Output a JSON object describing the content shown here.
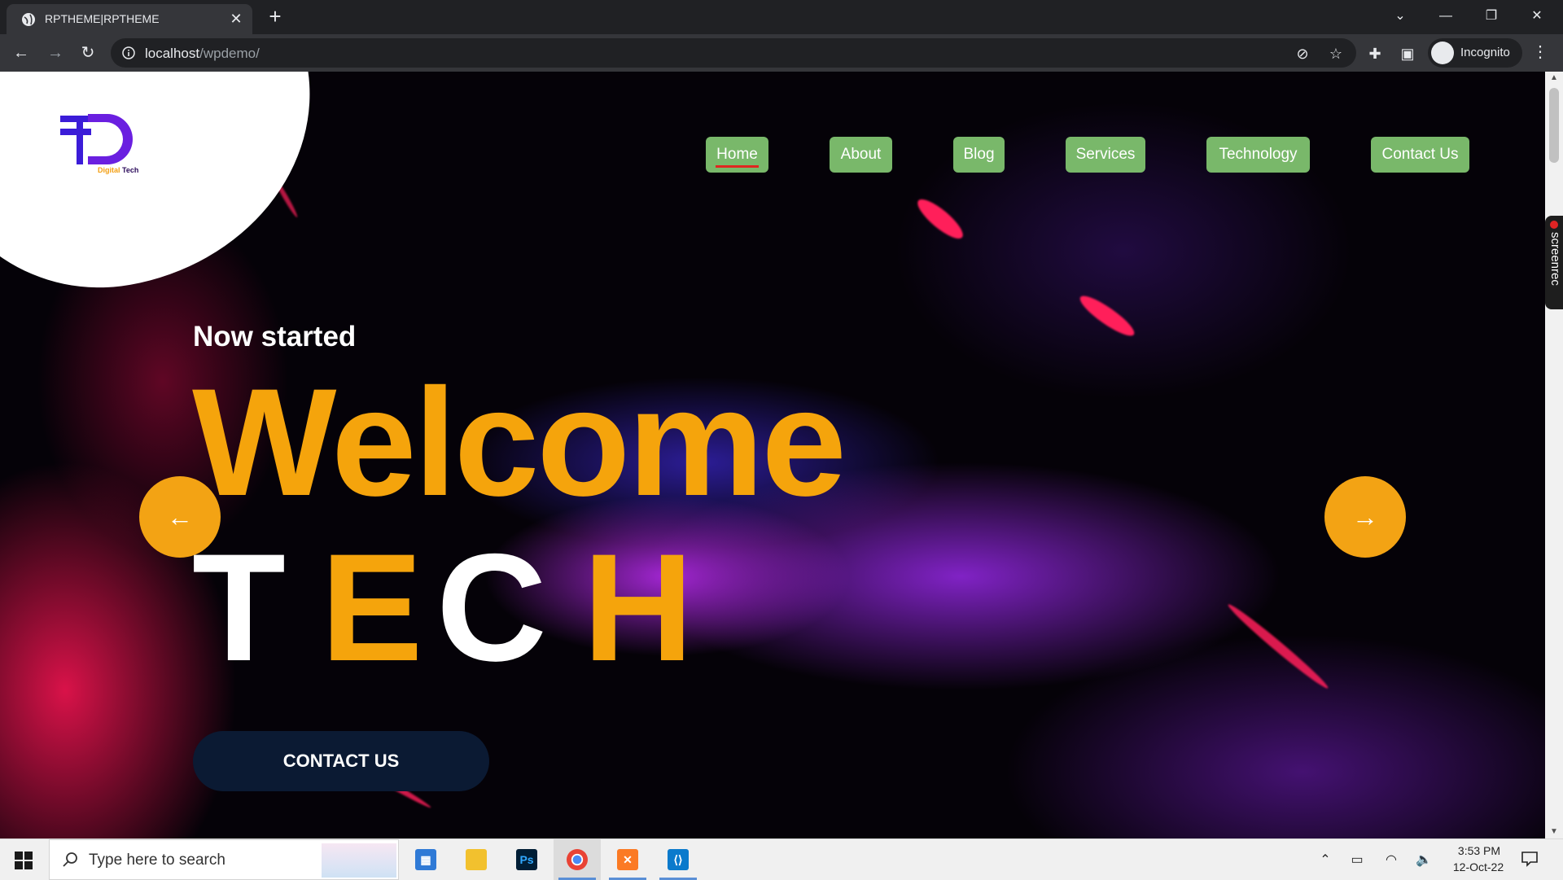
{
  "browser": {
    "tab_title": "RPTHEME|RPTHEME",
    "url_host": "localhost",
    "url_path": "/wpdemo/",
    "profile_label": "Incognito"
  },
  "site": {
    "logo_text_a": "Digital",
    "logo_text_b": "Tech",
    "nav": [
      "Home",
      "About",
      "Blog",
      "Services",
      "Technology",
      "Contact Us"
    ],
    "active_nav": "Home"
  },
  "hero": {
    "eyebrow": "Now started",
    "headline": "Welcome",
    "subword_letters": [
      "T",
      "E",
      "C",
      "H"
    ],
    "cta_label": "CONTACT US"
  },
  "overlay": {
    "screenrec_label": "screenrec"
  },
  "taskbar": {
    "search_placeholder": "Type here to search",
    "time": "3:53 PM",
    "date": "12-Oct-22"
  },
  "colors": {
    "accent_orange": "#f5a40c",
    "nav_green": "#79b86a",
    "cta_navy": "#0b1a33",
    "active_underline": "#e0261f"
  }
}
